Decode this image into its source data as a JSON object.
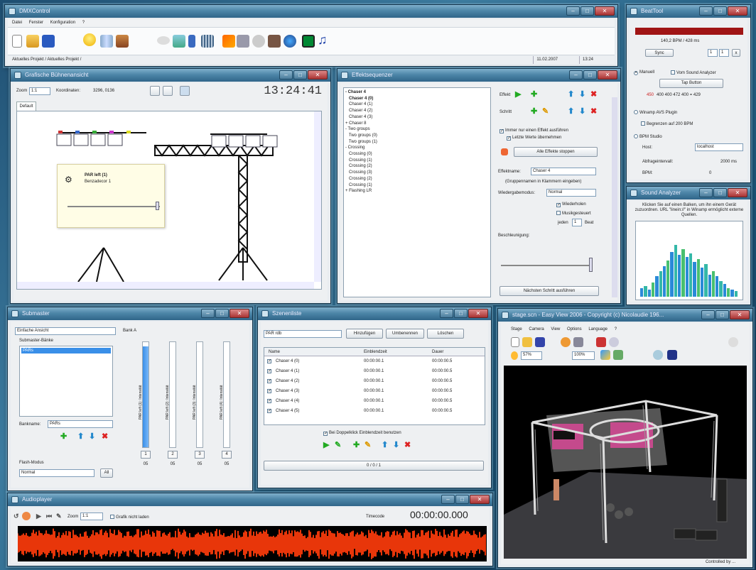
{
  "main": {
    "title": "DMXControl",
    "menu": [
      "Datei",
      "Fenster",
      "Konfiguration",
      "?"
    ],
    "status_left": "Aktuelles Projekt / Aktuelles Projekt /",
    "date": "11.02.2007",
    "time": "13:24"
  },
  "stage": {
    "title": "Grafische Bühnenansicht",
    "zoom_label": "Zoom",
    "zoom_value": "1:1",
    "coord_label": "Koordinaten:",
    "coord_value": "3296, 0136",
    "clock": "13:24:41",
    "tab_default": "Default",
    "popup_name": "PAR left (1)",
    "popup_sub": "Benzadecor 1"
  },
  "effect": {
    "title": "Effektsequenzer",
    "tree": [
      "- Chaser 4",
      "   Chaser 4 (0)",
      "   Chaser 4 (1)",
      "   Chaser 4 (2)",
      "   Chaser 4 (3)",
      "+ Chaser 8",
      "- Two groups",
      "   Two groups (0)",
      "   Two groups (1)",
      "- Crossing",
      "   Crossing (0)",
      "   Crossing (1)",
      "   Crossing (2)",
      "   Crossing (3)",
      "   Crossing (2)",
      "   Crossing (1)",
      "+ Flashing LR"
    ],
    "effekt_label": "Effekt",
    "schritt_label": "Schritt",
    "chk_einem": "Immer nur einen Effekt ausführen",
    "chk_letzte": "Letzte Werte übernehmen",
    "stop_all": "Alle Effekte stoppen",
    "name_label": "Effektname:",
    "name_value": "Chaser 4",
    "group_hint": "(Gruppennamen in Klammern eingeben)",
    "mode_label": "Wiedergabemodus:",
    "mode_value": "Normal",
    "chk_repeat": "Wiederholen",
    "chk_music": "Musikgesteuert",
    "jeden": "jeden",
    "beat_value": "1",
    "beat": "Beat",
    "accel_label": "Beschleunigung:",
    "next_step": "Nächsten Schritt ausführen"
  },
  "beat": {
    "title": "BeatTool",
    "bpm": "140,2 BPM / 428 ms",
    "sync": "Sync",
    "n1": "1",
    "n2": "1",
    "tap": "Tap Button",
    "manual": "Manuell",
    "sound": "Vom Sound Analyzer",
    "row_first": "450",
    "row": "400  400  472  400 = 429",
    "winamp": "Winamp AVS Plugin",
    "begrenzen": "Begrenzen auf 200 BPM",
    "studio": "BPM Studio",
    "host_label": "Host:",
    "host_value": "localhost",
    "interval_label": "Abfrageintervall:",
    "interval_value": "2000 ms",
    "bpm_label": "BPM:",
    "bpm_value": "0"
  },
  "sound": {
    "title": "Sound Analyzer",
    "text": "Klicken Sie auf einen Balken, um ihn einem Gerät zuzuordnen. URL \"linein://\" in Winamp ermöglicht externe Quellen.",
    "levels": [
      0.12,
      0.15,
      0.1,
      0.2,
      0.28,
      0.35,
      0.42,
      0.5,
      0.62,
      0.72,
      0.58,
      0.66,
      0.55,
      0.6,
      0.48,
      0.52,
      0.4,
      0.45,
      0.3,
      0.35,
      0.28,
      0.22,
      0.18,
      0.12,
      0.1,
      0.08
    ],
    "colors": [
      "#2a8ad8",
      "#34b8a8",
      "#2a8ad8",
      "#48c070"
    ]
  },
  "submaster": {
    "title": "Submaster",
    "view_select": "Einfache Ansicht",
    "banks_label": "Submaster-Bänke",
    "bank_item": "PARs",
    "bank_name_label": "Bankname:",
    "bank_name_value": "PARs",
    "flash_label": "Flash-Modus",
    "flash_value": "Normal",
    "all_btn": "All",
    "bank_title": "Bank A",
    "faders": [
      {
        "label": "PAR left (1): Intensität",
        "num": "1",
        "val": "05",
        "level": 0.96
      },
      {
        "label": "PAR left (2): Intensität",
        "num": "2",
        "val": "05",
        "level": 0
      },
      {
        "label": "PAR left (3): Intensität",
        "num": "3",
        "val": "05",
        "level": 0
      },
      {
        "label": "PAR left (4): Intensität",
        "num": "4",
        "val": "05",
        "level": 0
      }
    ]
  },
  "scene": {
    "title": "Szenenliste",
    "select": "PAR rdb",
    "add": "Hinzufügen",
    "rename": "Umbenennen",
    "delete": "Löschen",
    "headers": [
      "Name",
      "Einblendzeit",
      "Dauer"
    ],
    "rows": [
      {
        "name": "Chaser 4 (0)",
        "fade": "00:00:00.1",
        "dur": "00:00:00.5"
      },
      {
        "name": "Chaser 4 (1)",
        "fade": "00:00:00.1",
        "dur": "00:00:00.5"
      },
      {
        "name": "Chaser 4 (2)",
        "fade": "00:00:00.1",
        "dur": "00:00:00.5"
      },
      {
        "name": "Chaser 4 (3)",
        "fade": "00:00:00.1",
        "dur": "00:00:00.5"
      },
      {
        "name": "Chaser 4 (4)",
        "fade": "00:00:00.1",
        "dur": "00:00:00.5"
      },
      {
        "name": "Chaser 4 (5)",
        "fade": "00:00:00.1",
        "dur": "00:00:00.5"
      }
    ],
    "chk_double": "Bei Doppelklick Einblendzeit benutzen",
    "counter": "0 / 0 / 1"
  },
  "audio": {
    "title": "Audioplayer",
    "zoom_label": "Zoom",
    "zoom_value": "1:1",
    "no_graph": "Grafik nicht laden",
    "timecode_label": "Timecode",
    "timecode": "00:00:00.000"
  },
  "view3d": {
    "title": "stage.scn - Easy View 2006 - Copyright (c) Nicolaudie 196...",
    "menu": [
      "Stage",
      "Camera",
      "View",
      "Options",
      "Language",
      "?"
    ],
    "zoom1": "57%",
    "zoom2": "100%",
    "status": "Controlled by ..."
  }
}
